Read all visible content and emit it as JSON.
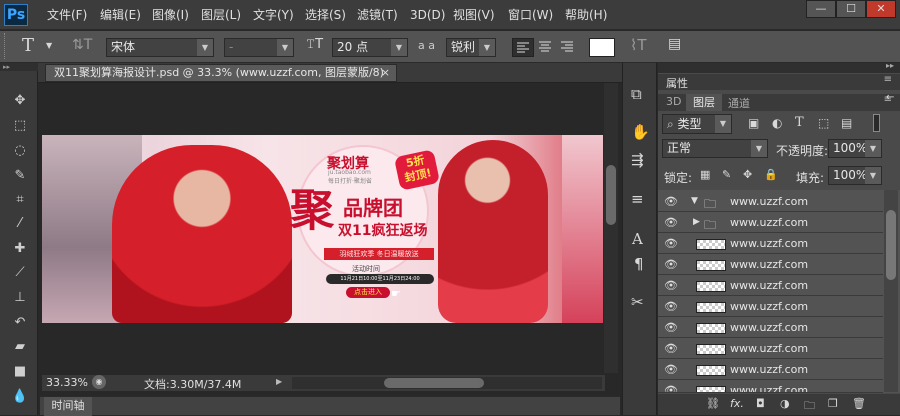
{
  "app": {
    "logo": "Ps",
    "menus": [
      "文件(F)",
      "编辑(E)",
      "图像(I)",
      "图层(L)",
      "文字(Y)",
      "选择(S)",
      "滤镜(T)",
      "3D(D)",
      "视图(V)",
      "窗口(W)",
      "帮助(H)"
    ],
    "window_buttons": [
      "—",
      "☐",
      "✕"
    ]
  },
  "options": {
    "font_family": "宋体",
    "font_style": "-",
    "font_size": "20 点",
    "aa_label": "a a",
    "antialias": "锐利"
  },
  "document": {
    "tab_title": "双11聚划算海报设计.psd @ 33.3% (www.uzzf.com, 图层蒙版/8)",
    "tab_close": "×"
  },
  "banner": {
    "brand": "聚划算",
    "brand_url": "ju.taobao.com",
    "brand_sub": "每日打折·聚划省",
    "badge_line1": "5折",
    "badge_line2": "封顶!",
    "big_char": "聚",
    "title1": "品牌团",
    "title2": "双11疯狂返场",
    "red_strip": "羽绒狂欢季 冬日温暖放送",
    "activity": "活动时间",
    "dates": "11月21日10:00至11月23日24:00",
    "enter": "点击进入"
  },
  "status": {
    "zoom": "33.33%",
    "doc_size": "文档:3.30M/37.4M"
  },
  "timeline": {
    "label": "时间轴"
  },
  "panel": {
    "tab_properties": "属性",
    "tab_3d": "3D",
    "tab_layers": "图层",
    "tab_channels": "通道",
    "filter_label": "类型",
    "blend_mode": "正常",
    "opacity_label": "不透明度:",
    "opacity": "100%",
    "lock_label": "锁定:",
    "fill_label": "填充:",
    "fill": "100%"
  },
  "layers": [
    {
      "name": "www.uzzf.com",
      "type": "group-open"
    },
    {
      "name": "www.uzzf.com",
      "type": "group"
    },
    {
      "name": "www.uzzf.com",
      "type": "layer"
    },
    {
      "name": "www.uzzf.com",
      "type": "layer"
    },
    {
      "name": "www.uzzf.com",
      "type": "layer"
    },
    {
      "name": "www.uzzf.com",
      "type": "layer"
    },
    {
      "name": "www.uzzf.com",
      "type": "layer"
    },
    {
      "name": "www.uzzf.com",
      "type": "layer"
    },
    {
      "name": "www.uzzf.com",
      "type": "layer"
    },
    {
      "name": "www.uzzf.com",
      "type": "layer"
    }
  ],
  "panel_footer": {
    "fx": "fx."
  }
}
